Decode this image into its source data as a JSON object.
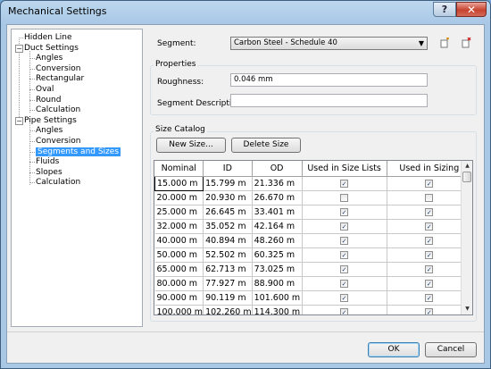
{
  "window": {
    "title": "Mechanical Settings",
    "help_label": "?",
    "close_label": "✕"
  },
  "tree": {
    "items": [
      {
        "label": "Hidden Line"
      },
      {
        "label": "Duct Settings",
        "expander": "−"
      },
      {
        "label": "Angles"
      },
      {
        "label": "Conversion"
      },
      {
        "label": "Rectangular"
      },
      {
        "label": "Oval"
      },
      {
        "label": "Round"
      },
      {
        "label": "Calculation"
      },
      {
        "label": "Pipe Settings",
        "expander": "−"
      },
      {
        "label": "Angles"
      },
      {
        "label": "Conversion"
      },
      {
        "label": "Segments and Sizes",
        "selected": true
      },
      {
        "label": "Fluids"
      },
      {
        "label": "Slopes"
      },
      {
        "label": "Calculation"
      }
    ]
  },
  "segment": {
    "label": "Segment:",
    "value": "Carbon Steel - Schedule 40",
    "arrow": "▼"
  },
  "properties": {
    "title": "Properties",
    "roughness_label": "Roughness:",
    "roughness_value": "0.046 mm",
    "description_label": "Segment Description:",
    "description_value": ""
  },
  "size_catalog": {
    "title": "Size Catalog",
    "new_size_label": "New Size...",
    "delete_size_label": "Delete Size",
    "columns": [
      "Nominal",
      "ID",
      "OD",
      "Used in Size Lists",
      "Used in Sizing"
    ],
    "rows": [
      {
        "nominal": "15.000 m",
        "id": "15.799 m",
        "od": "21.336 m",
        "size_lists": true,
        "sizing": true
      },
      {
        "nominal": "20.000 m",
        "id": "20.930 m",
        "od": "26.670 m",
        "size_lists": false,
        "sizing": false
      },
      {
        "nominal": "25.000 m",
        "id": "26.645 m",
        "od": "33.401 m",
        "size_lists": true,
        "sizing": true
      },
      {
        "nominal": "32.000 m",
        "id": "35.052 m",
        "od": "42.164 m",
        "size_lists": true,
        "sizing": true
      },
      {
        "nominal": "40.000 m",
        "id": "40.894 m",
        "od": "48.260 m",
        "size_lists": true,
        "sizing": true
      },
      {
        "nominal": "50.000 m",
        "id": "52.502 m",
        "od": "60.325 m",
        "size_lists": true,
        "sizing": true
      },
      {
        "nominal": "65.000 m",
        "id": "62.713 m",
        "od": "73.025 m",
        "size_lists": true,
        "sizing": true
      },
      {
        "nominal": "80.000 m",
        "id": "77.927 m",
        "od": "88.900 m",
        "size_lists": true,
        "sizing": true
      },
      {
        "nominal": "90.000 m",
        "id": "90.119 m",
        "od": "101.600 m",
        "size_lists": true,
        "sizing": true
      },
      {
        "nominal": "100.000 m",
        "id": "102.260 m",
        "od": "114.300 m",
        "size_lists": true,
        "sizing": true
      }
    ]
  },
  "footer": {
    "ok_label": "OK",
    "cancel_label": "Cancel"
  },
  "icons": {
    "new_segment": "new-segment-icon",
    "delete_segment": "delete-segment-icon"
  },
  "colors": {
    "selection": "#3399ff",
    "title_bar": "#a9c8e6",
    "close_button": "#c7432f"
  }
}
